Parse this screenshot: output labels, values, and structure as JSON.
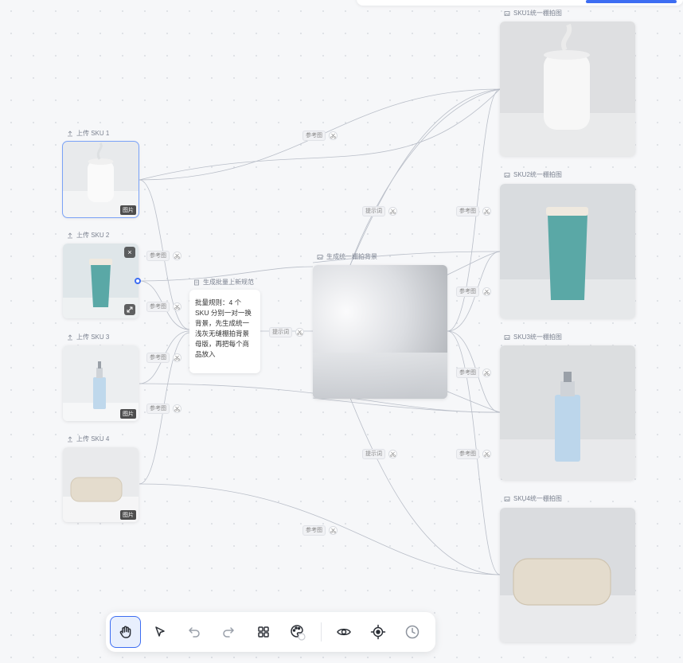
{
  "canvas": {
    "source_nodes": [
      {
        "label": "上传 SKU 1",
        "badge": "图片",
        "image": "humidifier"
      },
      {
        "label": "上传 SKU 2",
        "image": "tumbler"
      },
      {
        "label": "上传 SKU 3",
        "badge": "图片",
        "image": "perfume-bottle"
      },
      {
        "label": "上传 SKU 4",
        "badge": "图片",
        "image": "speaker"
      }
    ],
    "text_node": {
      "label": "生成批量上新规范",
      "content": "批量规则：4 个 SKU 分别一对一换背景，先生成统一浅灰无缝棚拍背景母版，再把每个商品放入"
    },
    "background_node": {
      "label": "生成统一棚拍背景"
    },
    "output_nodes": [
      {
        "label": "SKU1统一棚拍图",
        "image": "humidifier"
      },
      {
        "label": "SKU2统一棚拍图",
        "image": "tumbler"
      },
      {
        "label": "SKU3统一棚拍图",
        "image": "perfume-bottle"
      },
      {
        "label": "SKU4统一棚拍图",
        "image": "speaker"
      }
    ],
    "edge_labels": {
      "ref": "参考图",
      "prompt": "提示词"
    }
  },
  "card_controls": {
    "close_icon": "close-icon",
    "expand_icon": "expand-icon"
  },
  "toolbar": {
    "items": [
      {
        "name": "hand-tool",
        "icon": "hand-icon",
        "active": true
      },
      {
        "name": "select-tool",
        "icon": "pointer-icon"
      },
      {
        "name": "undo",
        "icon": "undo-icon"
      },
      {
        "name": "redo",
        "icon": "redo-icon"
      },
      {
        "name": "grid",
        "icon": "grid-icon"
      },
      {
        "name": "palette",
        "icon": "palette-icon"
      },
      {
        "name": "preview",
        "icon": "eye-icon"
      },
      {
        "name": "locate",
        "icon": "target-icon"
      },
      {
        "name": "history",
        "icon": "clock-icon"
      }
    ]
  },
  "colors": {
    "accent": "#3d6df2",
    "canvas_bg": "#f6f7f9",
    "edge": "#b9bec8"
  }
}
